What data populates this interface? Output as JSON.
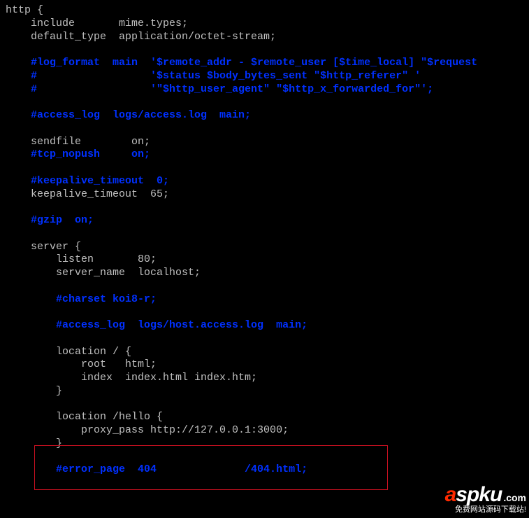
{
  "lines": [
    {
      "cls": "tok-txt",
      "text": "http {"
    },
    {
      "cls": "tok-txt",
      "text": "    include       mime.types;"
    },
    {
      "cls": "tok-txt",
      "text": "    default_type  application/octet-stream;"
    },
    {
      "cls": "tok-txt",
      "text": ""
    },
    {
      "cls": "tok-comment",
      "text": "    #log_format  main  '$remote_addr - $remote_user [$time_local] \"$request"
    },
    {
      "cls": "tok-comment",
      "text": "    #                  '$status $body_bytes_sent \"$http_referer\" '"
    },
    {
      "cls": "tok-comment",
      "text": "    #                  '\"$http_user_agent\" \"$http_x_forwarded_for\"';"
    },
    {
      "cls": "tok-txt",
      "text": ""
    },
    {
      "cls": "tok-comment",
      "text": "    #access_log  logs/access.log  main;"
    },
    {
      "cls": "tok-txt",
      "text": ""
    },
    {
      "cls": "tok-txt",
      "text": "    sendfile        on;"
    },
    {
      "cls": "tok-comment",
      "text": "    #tcp_nopush     on;"
    },
    {
      "cls": "tok-txt",
      "text": ""
    },
    {
      "cls": "tok-comment",
      "text": "    #keepalive_timeout  0;"
    },
    {
      "cls": "tok-txt",
      "text": "    keepalive_timeout  65;"
    },
    {
      "cls": "tok-txt",
      "text": ""
    },
    {
      "cls": "tok-comment",
      "text": "    #gzip  on;"
    },
    {
      "cls": "tok-txt",
      "text": ""
    },
    {
      "cls": "tok-txt",
      "text": "    server {"
    },
    {
      "cls": "tok-txt",
      "text": "        listen       80;"
    },
    {
      "cls": "tok-txt",
      "text": "        server_name  localhost;"
    },
    {
      "cls": "tok-txt",
      "text": ""
    },
    {
      "cls": "tok-comment",
      "text": "        #charset koi8-r;"
    },
    {
      "cls": "tok-txt",
      "text": ""
    },
    {
      "cls": "tok-comment",
      "text": "        #access_log  logs/host.access.log  main;"
    },
    {
      "cls": "tok-txt",
      "text": ""
    },
    {
      "cls": "tok-txt",
      "text": "        location / {"
    },
    {
      "cls": "tok-txt",
      "text": "            root   html;"
    },
    {
      "cls": "tok-txt",
      "text": "            index  index.html index.htm;"
    },
    {
      "cls": "tok-txt",
      "text": "        }"
    },
    {
      "cls": "tok-txt",
      "text": ""
    },
    {
      "cls": "tok-txt",
      "text": "        location /hello {"
    },
    {
      "cls": "tok-txt",
      "text": "            proxy_pass http://127.0.0.1:3000;"
    },
    {
      "cls": "tok-txt",
      "text": "        }"
    },
    {
      "cls": "tok-txt",
      "text": ""
    },
    {
      "cls": "tok-comment",
      "text": "        #error_page  404              /404.html;"
    }
  ],
  "watermark": {
    "a": "a",
    "spku": "spku",
    "dot": ".",
    "com": "com",
    "sub": "免费网站源码下载站!"
  }
}
